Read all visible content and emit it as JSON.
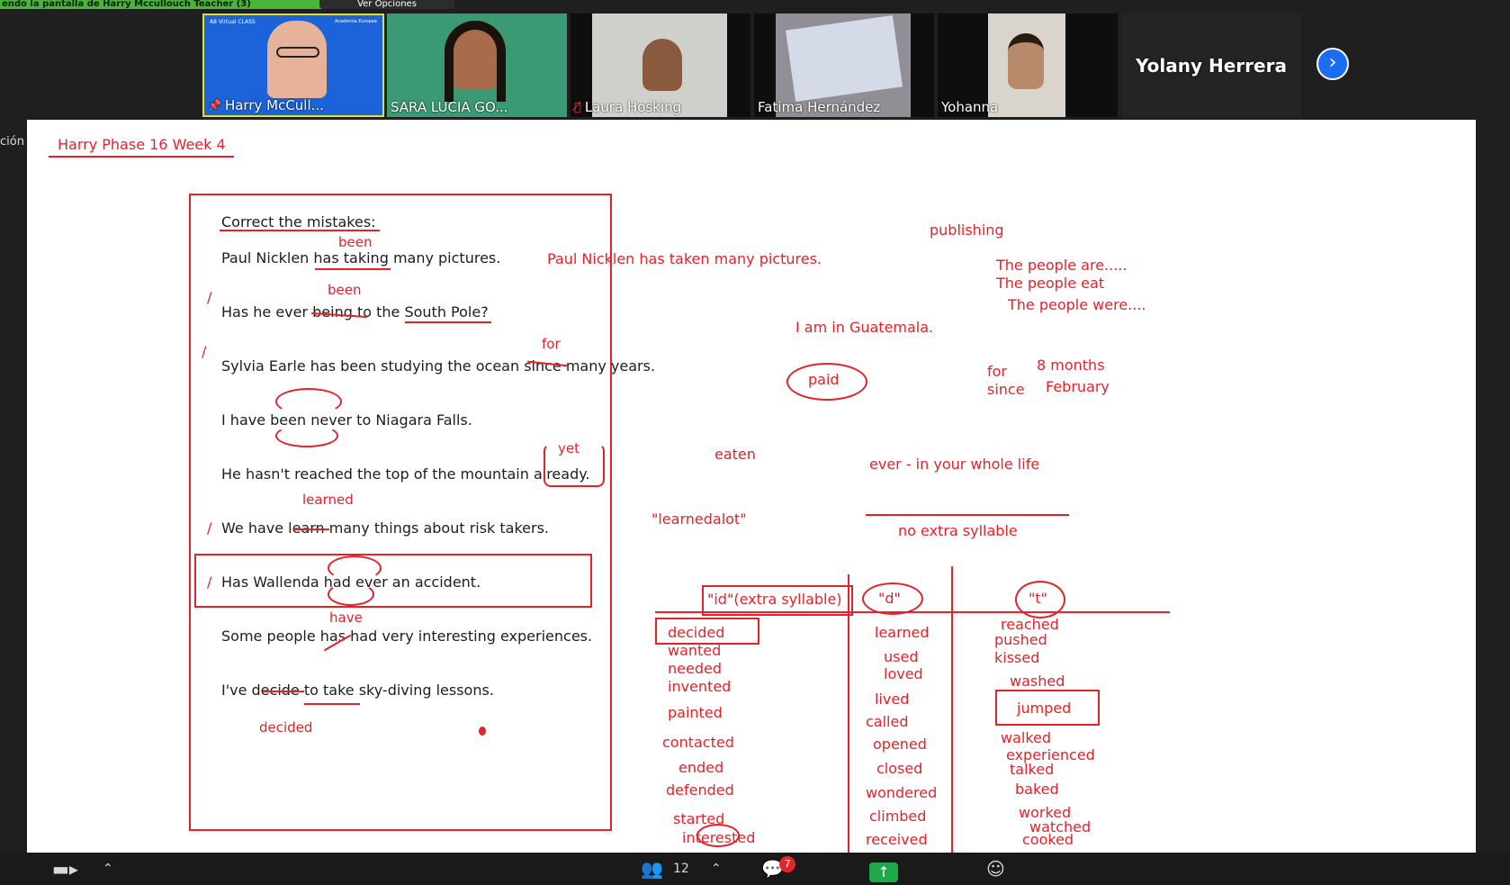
{
  "top_bar": {
    "share_banner": "endo la pantalla de Harry Mccullouch Teacher (3)",
    "view_options": "Ver Opciones"
  },
  "participants": [
    {
      "name": "Harry McCull...",
      "pinned": true,
      "muted": false
    },
    {
      "name": "SARA LUCIA GO...",
      "pinned": false,
      "muted": false
    },
    {
      "name": "Laura Hosking",
      "pinned": false,
      "muted": true
    },
    {
      "name": "Fatima Hernández",
      "pinned": false,
      "muted": false
    },
    {
      "name": "Yohanna",
      "pinned": false,
      "muted": false
    },
    {
      "name": "Yolany Herrera",
      "pinned": false,
      "muted": false
    }
  ],
  "avatar_badge": {
    "class_name": "A8 Virtual CLASS",
    "academy": "Academia Europea"
  },
  "side_label": "ción",
  "whiteboard": {
    "title": "Harry Phase 16 Week 4",
    "exercise_heading": "Correct the mistakes:",
    "sentences": [
      "Paul Nicklen has taking many pictures.",
      "Has he ever being to the South Pole?",
      "Sylvia Earle has been studying the ocean since many years.",
      "I have been never to Niagara Falls.",
      "He hasn't reached the top of the mountain already.",
      "We have learn many things about risk takers.",
      "Has Wallenda had ever an accident.",
      "Some people has had very interesting experiences.",
      "I've decide to take sky-diving lessons."
    ],
    "corrections": {
      "been1": "been",
      "been2": "been",
      "for": "for",
      "yet": "yet",
      "learned": "learned",
      "have": "have",
      "decided": "decided"
    },
    "notes": {
      "corrected_sentence": "Paul Nicklen has taken many pictures.",
      "publishing": "publishing",
      "people_are": "The people are.....",
      "people_eat": "The people eat",
      "people_were": "The people were....",
      "guatemala": "I am in Guatemala.",
      "for": "for",
      "since": "since",
      "eight_months": "8 months",
      "february": "February",
      "paid": "paid",
      "eaten": "eaten",
      "ever_life": "ever - in your whole life",
      "learnedalot": "\"learnedalot\"",
      "no_extra": "no extra syllable"
    },
    "pronunciation_table": {
      "headers": [
        "\"id\"(extra syllable)",
        "\"d\"",
        "\"t\""
      ],
      "id_words": [
        "decided",
        "wanted",
        "needed",
        "invented",
        "painted",
        "contacted",
        "ended",
        "defended",
        "started",
        "interested"
      ],
      "d_words": [
        "learned",
        "used",
        "loved",
        "lived",
        "called",
        "opened",
        "closed",
        "wondered",
        "climbed",
        "received"
      ],
      "t_words": [
        "reached",
        "pushed",
        "kissed",
        "washed",
        "jumped",
        "walked",
        "experienced",
        "talked",
        "baked",
        "worked",
        "watched",
        "cooked"
      ]
    }
  },
  "toolbar": {
    "participants_count": "12",
    "chat_badge": "7"
  },
  "colors": {
    "ink": "#e5222a",
    "board": "#ffffff",
    "chrome": "#1f1f1f",
    "banner": "#49b33a",
    "accent": "#1a6cf0"
  },
  "icons": [
    "pin-icon",
    "mic-muted-icon",
    "next-arrow-icon",
    "camera-icon",
    "chevron-up-icon",
    "participants-icon",
    "chat-icon",
    "share-screen-icon",
    "reactions-icon"
  ]
}
